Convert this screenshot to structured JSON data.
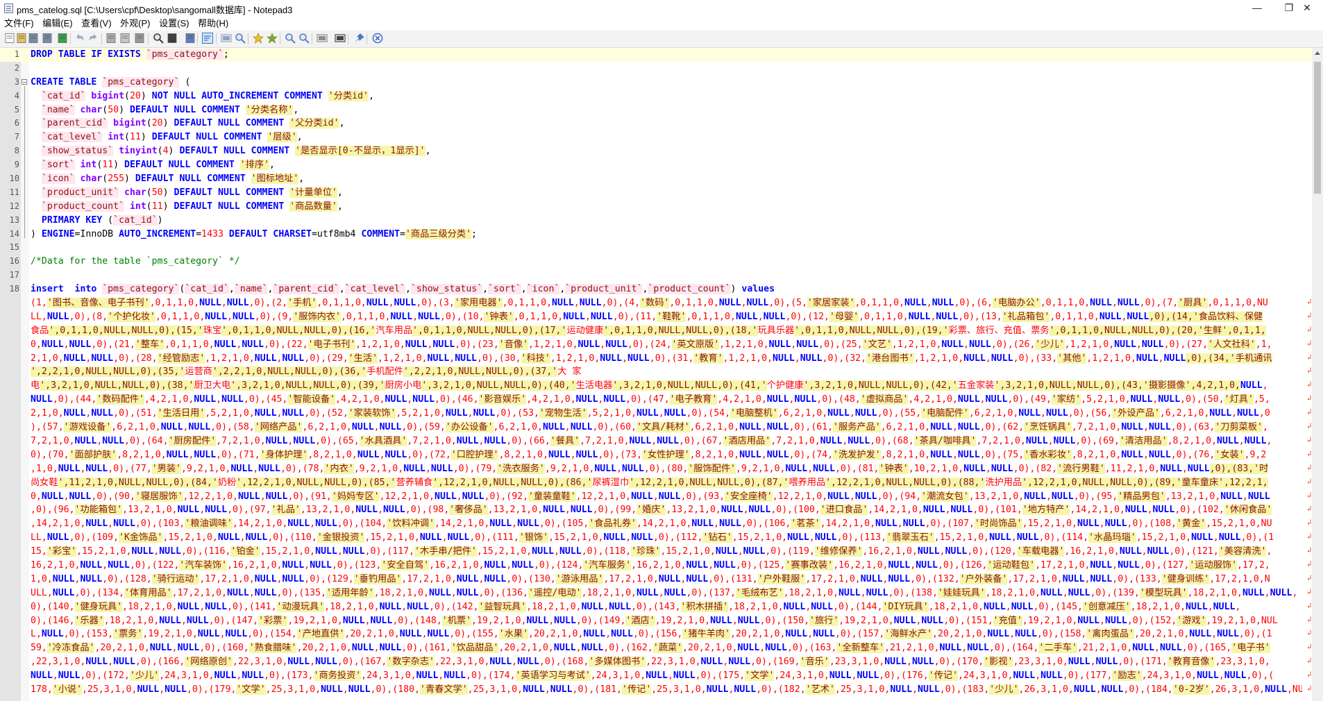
{
  "window": {
    "title": "pms_catelog.sql [C:\\Users\\cpf\\Desktop\\sangomall数据库] - Notepad3",
    "minimize": "—",
    "restore": "❐",
    "close": "✕"
  },
  "menu": [
    "文件(F)",
    "编辑(E)",
    "查看(V)",
    "外观(P)",
    "设置(S)",
    "帮助(H)"
  ],
  "toolbar": [
    "new-file-icon",
    "open-file-icon",
    "save-icon",
    "save-as-icon",
    "browse-icon",
    "undo-icon",
    "redo-icon",
    "cut-icon",
    "copy-icon",
    "paste-icon",
    "find-icon",
    "replace-icon",
    "goto-icon",
    "word-wrap-icon",
    "view-indent-icon",
    "zoom-icon",
    "bookmark-icon",
    "bookmark-all-icon",
    "zoom-in-icon",
    "zoom-out-icon",
    "schema-icon",
    "fullscreen-icon",
    "pin-icon",
    "exit-icon"
  ],
  "editor": {
    "lines": [
      {
        "n": "1",
        "t": [
          [
            "kw",
            "DROP TABLE IF EXISTS "
          ],
          [
            "bt",
            "`pms_category`"
          ],
          [
            "p",
            ";"
          ]
        ]
      },
      {
        "n": "2",
        "t": []
      },
      {
        "n": "3",
        "t": [
          [
            "kw",
            "CREATE TABLE "
          ],
          [
            "bt",
            "`pms_category`"
          ],
          [
            "p",
            " ("
          ]
        ]
      },
      {
        "n": "4",
        "t": [
          [
            "p",
            "  "
          ],
          [
            "bt",
            "`cat_id`"
          ],
          [
            "p",
            " "
          ],
          [
            "ty",
            "bigint"
          ],
          [
            "p",
            "("
          ],
          [
            "num",
            "20"
          ],
          [
            "p",
            ") "
          ],
          [
            "kw",
            "NOT NULL AUTO_INCREMENT COMMENT "
          ],
          [
            "str",
            "'分类id'"
          ],
          [
            "p",
            ","
          ]
        ]
      },
      {
        "n": "5",
        "t": [
          [
            "p",
            "  "
          ],
          [
            "bt",
            "`name`"
          ],
          [
            "p",
            " "
          ],
          [
            "ty",
            "char"
          ],
          [
            "p",
            "("
          ],
          [
            "num",
            "50"
          ],
          [
            "p",
            ") "
          ],
          [
            "kw",
            "DEFAULT NULL COMMENT "
          ],
          [
            "str",
            "'分类名称'"
          ],
          [
            "p",
            ","
          ]
        ]
      },
      {
        "n": "6",
        "t": [
          [
            "p",
            "  "
          ],
          [
            "bt",
            "`parent_cid`"
          ],
          [
            "p",
            " "
          ],
          [
            "ty",
            "bigint"
          ],
          [
            "p",
            "("
          ],
          [
            "num",
            "20"
          ],
          [
            "p",
            ") "
          ],
          [
            "kw",
            "DEFAULT NULL COMMENT "
          ],
          [
            "str",
            "'父分类id'"
          ],
          [
            "p",
            ","
          ]
        ]
      },
      {
        "n": "7",
        "t": [
          [
            "p",
            "  "
          ],
          [
            "bt",
            "`cat_level`"
          ],
          [
            "p",
            " "
          ],
          [
            "ty",
            "int"
          ],
          [
            "p",
            "("
          ],
          [
            "num",
            "11"
          ],
          [
            "p",
            ") "
          ],
          [
            "kw",
            "DEFAULT NULL COMMENT "
          ],
          [
            "str",
            "'层级'"
          ],
          [
            "p",
            ","
          ]
        ]
      },
      {
        "n": "8",
        "t": [
          [
            "p",
            "  "
          ],
          [
            "bt",
            "`show_status`"
          ],
          [
            "p",
            " "
          ],
          [
            "ty",
            "tinyint"
          ],
          [
            "p",
            "("
          ],
          [
            "num",
            "4"
          ],
          [
            "p",
            ") "
          ],
          [
            "kw",
            "DEFAULT NULL COMMENT "
          ],
          [
            "str",
            "'是否显示[0-不显示，1显示]'"
          ],
          [
            "p",
            ","
          ]
        ]
      },
      {
        "n": "9",
        "t": [
          [
            "p",
            "  "
          ],
          [
            "bt",
            "`sort`"
          ],
          [
            "p",
            " "
          ],
          [
            "ty",
            "int"
          ],
          [
            "p",
            "("
          ],
          [
            "num",
            "11"
          ],
          [
            "p",
            ") "
          ],
          [
            "kw",
            "DEFAULT NULL COMMENT "
          ],
          [
            "str",
            "'排序'"
          ],
          [
            "p",
            ","
          ]
        ]
      },
      {
        "n": "10",
        "t": [
          [
            "p",
            "  "
          ],
          [
            "bt",
            "`icon`"
          ],
          [
            "p",
            " "
          ],
          [
            "ty",
            "char"
          ],
          [
            "p",
            "("
          ],
          [
            "num",
            "255"
          ],
          [
            "p",
            ") "
          ],
          [
            "kw",
            "DEFAULT NULL COMMENT "
          ],
          [
            "str",
            "'图标地址'"
          ],
          [
            "p",
            ","
          ]
        ]
      },
      {
        "n": "11",
        "t": [
          [
            "p",
            "  "
          ],
          [
            "bt",
            "`product_unit`"
          ],
          [
            "p",
            " "
          ],
          [
            "ty",
            "char"
          ],
          [
            "p",
            "("
          ],
          [
            "num",
            "50"
          ],
          [
            "p",
            ") "
          ],
          [
            "kw",
            "DEFAULT NULL COMMENT "
          ],
          [
            "str",
            "'计量单位'"
          ],
          [
            "p",
            ","
          ]
        ]
      },
      {
        "n": "12",
        "t": [
          [
            "p",
            "  "
          ],
          [
            "bt",
            "`product_count`"
          ],
          [
            "p",
            " "
          ],
          [
            "ty",
            "int"
          ],
          [
            "p",
            "("
          ],
          [
            "num",
            "11"
          ],
          [
            "p",
            ") "
          ],
          [
            "kw",
            "DEFAULT NULL COMMENT "
          ],
          [
            "str",
            "'商品数量'"
          ],
          [
            "p",
            ","
          ]
        ]
      },
      {
        "n": "13",
        "t": [
          [
            "p",
            "  "
          ],
          [
            "kw",
            "PRIMARY KEY "
          ],
          [
            "p",
            "("
          ],
          [
            "bt",
            "`cat_id`"
          ],
          [
            "p",
            ")"
          ]
        ]
      },
      {
        "n": "14",
        "t": [
          [
            "p",
            ") "
          ],
          [
            "kw",
            "ENGINE"
          ],
          [
            "p",
            "=InnoDB "
          ],
          [
            "kw",
            "AUTO_INCREMENT"
          ],
          [
            "p",
            "="
          ],
          [
            "num",
            "1433"
          ],
          [
            "p",
            " "
          ],
          [
            "kw",
            "DEFAULT CHARSET"
          ],
          [
            "p",
            "=utf8mb4 "
          ],
          [
            "kw",
            "COMMENT"
          ],
          [
            "p",
            "="
          ],
          [
            "str",
            "'商品三级分类'"
          ],
          [
            "p",
            ";"
          ]
        ]
      },
      {
        "n": "15",
        "t": []
      },
      {
        "n": "16",
        "t": [
          [
            "cm",
            "/*Data for the table `pms_category` */"
          ]
        ]
      },
      {
        "n": "17",
        "t": []
      },
      {
        "n": "18",
        "t": [
          [
            "kw",
            "insert  into "
          ],
          [
            "bt",
            "`pms_category`"
          ],
          [
            "p",
            "("
          ],
          [
            "bt",
            "`cat_id`"
          ],
          [
            "p",
            ","
          ],
          [
            "bt",
            "`name`"
          ],
          [
            "p",
            ","
          ],
          [
            "bt",
            "`parent_cid`"
          ],
          [
            "p",
            ","
          ],
          [
            "bt",
            "`cat_level`"
          ],
          [
            "p",
            ","
          ],
          [
            "bt",
            "`show_status`"
          ],
          [
            "p",
            ","
          ],
          [
            "bt",
            "`sort`"
          ],
          [
            "p",
            ","
          ],
          [
            "bt",
            "`icon`"
          ],
          [
            "p",
            ","
          ],
          [
            "bt",
            "`product_unit`"
          ],
          [
            "p",
            ","
          ],
          [
            "bt",
            "`product_count`"
          ],
          [
            "p",
            ") "
          ],
          [
            "kw",
            "values"
          ]
        ]
      }
    ],
    "wrapped": [
      "(1,'图书、音像、电子书刊',0,1,1,0,NULL,NULL,0),(2,'手机',0,1,1,0,NULL,NULL,0),(3,'家用电器',0,1,1,0,NULL,NULL,0),(4,'数码',0,1,1,0,NULL,NULL,0),(5,'家居家装',0,1,1,0,NULL,NULL,0),(6,'电脑办公',0,1,1,0,NULL,NULL,0),(7,'厨具',0,1,1,0,NU",
      "LL,NULL,0),(8,'个护化妆',0,1,1,0,NULL,NULL,0),(9,'服饰内衣',0,1,1,0,NULL,NULL,0),(10,'钟表',0,1,1,0,NULL,NULL,0),(11,'鞋靴',0,1,1,0,NULL,NULL,0),(12,'母婴',0,1,1,0,NULL,NULL,0),(13,'礼品箱包',0,1,1,0,NULL,NULL,0),(14,'食品饮料、保健",
      "食品',0,1,1,0,NULL,NULL,0),(15,'珠宝',0,1,1,0,NULL,NULL,0),(16,'汽车用品',0,1,1,0,NULL,NULL,0),(17,'运动健康',0,1,1,0,NULL,NULL,0),(18,'玩具乐器',0,1,1,0,NULL,NULL,0),(19,'彩票、旅行、充值、票务',0,1,1,0,NULL,NULL,0),(20,'生鲜',0,1,1,",
      "0,NULL,NULL,0),(21,'整车',0,1,1,0,NULL,NULL,0),(22,'电子书刊',1,2,1,0,NULL,NULL,0),(23,'音像',1,2,1,0,NULL,NULL,0),(24,'英文原版',1,2,1,0,NULL,NULL,0),(25,'文艺',1,2,1,0,NULL,NULL,0),(26,'少儿',1,2,1,0,NULL,NULL,0),(27,'人文社科',1,",
      "2,1,0,NULL,NULL,0),(28,'经管励志',1,2,1,0,NULL,NULL,0),(29,'生活',1,2,1,0,NULL,NULL,0),(30,'科技',1,2,1,0,NULL,NULL,0),(31,'教育',1,2,1,0,NULL,NULL,0),(32,'港台图书',1,2,1,0,NULL,NULL,0),(33,'其他',1,2,1,0,NULL,NULL,0),(34,'手机通讯",
      "',2,2,1,0,NULL,NULL,0),(35,'运营商',2,2,1,0,NULL,NULL,0),(36,'手机配件',2,2,1,0,NULL,NULL,0),(37,'大 家",
      "电',3,2,1,0,NULL,NULL,0),(38,'厨卫大电',3,2,1,0,NULL,NULL,0),(39,'厨房小电',3,2,1,0,NULL,NULL,0),(40,'生活电器',3,2,1,0,NULL,NULL,0),(41,'个护健康',3,2,1,0,NULL,NULL,0),(42,'五金家装',3,2,1,0,NULL,NULL,0),(43,'摄影摄像',4,2,1,0,NULL,",
      "NULL,0),(44,'数码配件',4,2,1,0,NULL,NULL,0),(45,'智能设备',4,2,1,0,NULL,NULL,0),(46,'影音娱乐',4,2,1,0,NULL,NULL,0),(47,'电子教育',4,2,1,0,NULL,NULL,0),(48,'虚拟商品',4,2,1,0,NULL,NULL,0),(49,'家纺',5,2,1,0,NULL,NULL,0),(50,'灯具',5,",
      "2,1,0,NULL,NULL,0),(51,'生活日用',5,2,1,0,NULL,NULL,0),(52,'家装软饰',5,2,1,0,NULL,NULL,0),(53,'宠物生活',5,2,1,0,NULL,NULL,0),(54,'电脑整机',6,2,1,0,NULL,NULL,0),(55,'电脑配件',6,2,1,0,NULL,NULL,0),(56,'外设产品',6,2,1,0,NULL,NULL,0",
      "),(57,'游戏设备',6,2,1,0,NULL,NULL,0),(58,'网络产品',6,2,1,0,NULL,NULL,0),(59,'办公设备',6,2,1,0,NULL,NULL,0),(60,'文具/耗材',6,2,1,0,NULL,NULL,0),(61,'服务产品',6,2,1,0,NULL,NULL,0),(62,'烹饪锅具',7,2,1,0,NULL,NULL,0),(63,'刀剪菜板',",
      "7,2,1,0,NULL,NULL,0),(64,'厨房配件',7,2,1,0,NULL,NULL,0),(65,'水具酒具',7,2,1,0,NULL,NULL,0),(66,'餐具',7,2,1,0,NULL,NULL,0),(67,'酒店用品',7,2,1,0,NULL,NULL,0),(68,'茶具/咖啡具',7,2,1,0,NULL,NULL,0),(69,'清洁用品',8,2,1,0,NULL,NULL,",
      "0),(70,'面部护肤',8,2,1,0,NULL,NULL,0),(71,'身体护理',8,2,1,0,NULL,NULL,0),(72,'口腔护理',8,2,1,0,NULL,NULL,0),(73,'女性护理',8,2,1,0,NULL,NULL,0),(74,'洗发护发',8,2,1,0,NULL,NULL,0),(75,'香水彩妆',8,2,1,0,NULL,NULL,0),(76,'女装',9,2",
      ",1,0,NULL,NULL,0),(77,'男装',9,2,1,0,NULL,NULL,0),(78,'内衣',9,2,1,0,NULL,NULL,0),(79,'洗衣服务',9,2,1,0,NULL,NULL,0),(80,'服饰配件',9,2,1,0,NULL,NULL,0),(81,'钟表',10,2,1,0,NULL,NULL,0),(82,'流行男鞋',11,2,1,0,NULL,NULL,0),(83,'时",
      "尚女鞋',11,2,1,0,NULL,NULL,0),(84,'奶粉',12,2,1,0,NULL,NULL,0),(85,'营养辅食',12,2,1,0,NULL,NULL,0),(86,'尿裤湿巾',12,2,1,0,NULL,NULL,0),(87,'喂养用品',12,2,1,0,NULL,NULL,0),(88,'洗护用品',12,2,1,0,NULL,NULL,0),(89,'童车童床',12,2,1,",
      "0,NULL,NULL,0),(90,'寝居服饰',12,2,1,0,NULL,NULL,0),(91,'妈妈专区',12,2,1,0,NULL,NULL,0),(92,'童装童鞋',12,2,1,0,NULL,NULL,0),(93,'安全座椅',12,2,1,0,NULL,NULL,0),(94,'潮流女包',13,2,1,0,NULL,NULL,0),(95,'精品男包',13,2,1,0,NULL,NULL",
      ",0),(96,'功能箱包',13,2,1,0,NULL,NULL,0),(97,'礼品',13,2,1,0,NULL,NULL,0),(98,'奢侈品',13,2,1,0,NULL,NULL,0),(99,'婚庆',13,2,1,0,NULL,NULL,0),(100,'进口食品',14,2,1,0,NULL,NULL,0),(101,'地方特产',14,2,1,0,NULL,NULL,0),(102,'休闲食品'",
      ",14,2,1,0,NULL,NULL,0),(103,'粮油调味',14,2,1,0,NULL,NULL,0),(104,'饮料冲调',14,2,1,0,NULL,NULL,0),(105,'食品礼券',14,2,1,0,NULL,NULL,0),(106,'茗茶',14,2,1,0,NULL,NULL,0),(107,'时尚饰品',15,2,1,0,NULL,NULL,0),(108,'黄金',15,2,1,0,NU",
      "LL,NULL,0),(109,'K金饰品',15,2,1,0,NULL,NULL,0),(110,'金银投资',15,2,1,0,NULL,NULL,0),(111,'银饰',15,2,1,0,NULL,NULL,0),(112,'钻石',15,2,1,0,NULL,NULL,0),(113,'翡翠玉石',15,2,1,0,NULL,NULL,0),(114,'水晶玛瑙',15,2,1,0,NULL,NULL,0),(1",
      "15,'彩宝',15,2,1,0,NULL,NULL,0),(116,'铂金',15,2,1,0,NULL,NULL,0),(117,'木手串/把件',15,2,1,0,NULL,NULL,0),(118,'珍珠',15,2,1,0,NULL,NULL,0),(119,'维修保养',16,2,1,0,NULL,NULL,0),(120,'车载电器',16,2,1,0,NULL,NULL,0),(121,'美容清洗',",
      "16,2,1,0,NULL,NULL,0),(122,'汽车装饰',16,2,1,0,NULL,NULL,0),(123,'安全自驾',16,2,1,0,NULL,NULL,0),(124,'汽车服务',16,2,1,0,NULL,NULL,0),(125,'赛事改装',16,2,1,0,NULL,NULL,0),(126,'运动鞋包',17,2,1,0,NULL,NULL,0),(127,'运动服饰',17,2,",
      "1,0,NULL,NULL,0),(128,'骑行运动',17,2,1,0,NULL,NULL,0),(129,'垂钓用品',17,2,1,0,NULL,NULL,0),(130,'游泳用品',17,2,1,0,NULL,NULL,0),(131,'户外鞋服',17,2,1,0,NULL,NULL,0),(132,'户外装备',17,2,1,0,NULL,NULL,0),(133,'健身训练',17,2,1,0,N",
      "ULL,NULL,0),(134,'体育用品',17,2,1,0,NULL,NULL,0),(135,'适用年龄',18,2,1,0,NULL,NULL,0),(136,'遥控/电动',18,2,1,0,NULL,NULL,0),(137,'毛绒布艺',18,2,1,0,NULL,NULL,0),(138,'娃娃玩具',18,2,1,0,NULL,NULL,0),(139,'模型玩具',18,2,1,0,NULL,NULL,",
      "0),(140,'健身玩具',18,2,1,0,NULL,NULL,0),(141,'动漫玩具',18,2,1,0,NULL,NULL,0),(142,'益智玩具',18,2,1,0,NULL,NULL,0),(143,'积木拼插',18,2,1,0,NULL,NULL,0),(144,'DIY玩具',18,2,1,0,NULL,NULL,0),(145,'创意减压',18,2,1,0,NULL,NULL,",
      "0),(146,'乐器',18,2,1,0,NULL,NULL,0),(147,'彩票',19,2,1,0,NULL,NULL,0),(148,'机票',19,2,1,0,NULL,NULL,0),(149,'酒店',19,2,1,0,NULL,NULL,0),(150,'旅行',19,2,1,0,NULL,NULL,0),(151,'充值',19,2,1,0,NULL,NULL,0),(152,'游戏',19,2,1,0,NUL",
      "L,NULL,0),(153,'票务',19,2,1,0,NULL,NULL,0),(154,'产地直供',20,2,1,0,NULL,NULL,0),(155,'水果',20,2,1,0,NULL,NULL,0),(156,'猪牛羊肉',20,2,1,0,NULL,NULL,0),(157,'海鲜水产',20,2,1,0,NULL,NULL,0),(158,'禽肉蛋品',20,2,1,0,NULL,NULL,0),(1",
      "59,'冷冻食品',20,2,1,0,NULL,NULL,0),(160,'熟食腊味',20,2,1,0,NULL,NULL,0),(161,'饮品甜品',20,2,1,0,NULL,NULL,0),(162,'蔬菜',20,2,1,0,NULL,NULL,0),(163,'全新整车',21,2,1,0,NULL,NULL,0),(164,'二手车',21,2,1,0,NULL,NULL,0),(165,'电子书'",
      ",22,3,1,0,NULL,NULL,0),(166,'网络原创',22,3,1,0,NULL,NULL,0),(167,'数字杂志',22,3,1,0,NULL,NULL,0),(168,'多媒体图书',22,3,1,0,NULL,NULL,0),(169,'音乐',23,3,1,0,NULL,NULL,0),(170,'影视',23,3,1,0,NULL,NULL,0),(171,'教育音像',23,3,1,0,",
      "NULL,NULL,0),(172,'少儿',24,3,1,0,NULL,NULL,0),(173,'商务投资',24,3,1,0,NULL,NULL,0),(174,'英语学习与考试',24,3,1,0,NULL,NULL,0),(175,'文学',24,3,1,0,NULL,NULL,0),(176,'传记',24,3,1,0,NULL,NULL,0),(177,'励志',24,3,1,0,NULL,NULL,0),(",
      "178,'小说',25,3,1,0,NULL,NULL,0),(179,'文学',25,3,1,0,NULL,NULL,0),(180,'青春文学',25,3,1,0,NULL,NULL,0),(181,'传记',25,3,1,0,NULL,NULL,0),(182,'艺术',25,3,1,0,NULL,NULL,0),(183,'少儿',26,3,1,0,NULL,NULL,0),(184,'0-2岁',26,3,1,0,NULL,NU"
    ]
  }
}
